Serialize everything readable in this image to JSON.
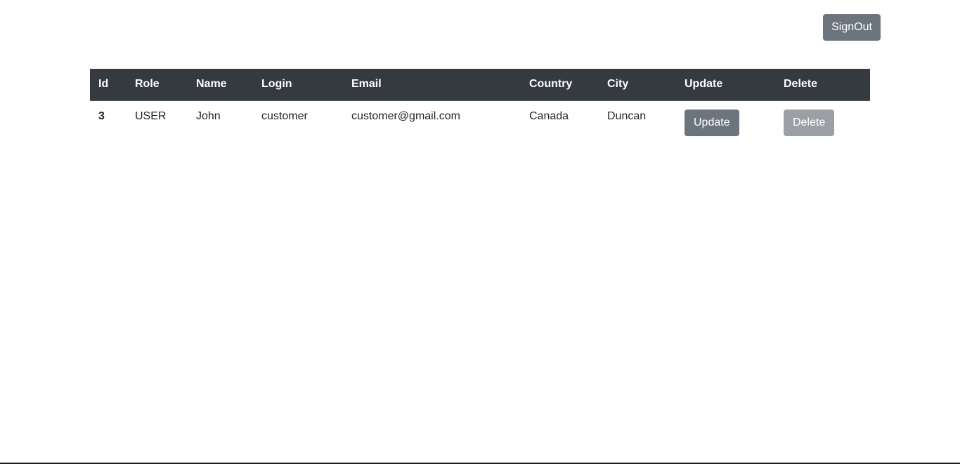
{
  "header": {
    "signout_label": "SignOut"
  },
  "table": {
    "columns": [
      "Id",
      "Role",
      "Name",
      "Login",
      "Email",
      "Country",
      "City",
      "Update",
      "Delete"
    ],
    "rows": [
      {
        "id": "3",
        "role": "USER",
        "name": "John",
        "login": "customer",
        "email": "customer@gmail.com",
        "country": "Canada",
        "city": "Duncan",
        "update_label": "Update",
        "delete_label": "Delete"
      }
    ]
  },
  "colors": {
    "header_bg": "#343a40",
    "button_secondary": "#6c757d",
    "button_disabled": "#9ca0a5"
  }
}
